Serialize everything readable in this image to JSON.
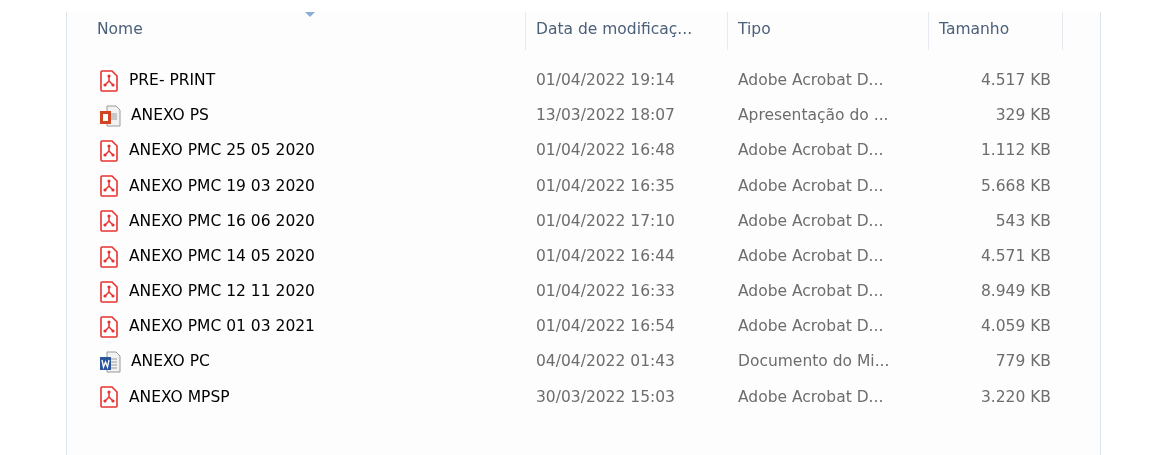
{
  "columns": [
    {
      "label": "Nome",
      "sorted": true
    },
    {
      "label": "Data de modificaç...",
      "sorted": false
    },
    {
      "label": "Tipo",
      "sorted": false
    },
    {
      "label": "Tamanho",
      "sorted": false
    }
  ],
  "files": [
    {
      "kind": "pdf",
      "name": "PRE- PRINT",
      "date": "01/04/2022 19:14",
      "type": "Adobe Acrobat D...",
      "size": "4.517 KB"
    },
    {
      "kind": "ppt",
      "name": "ANEXO PS",
      "date": "13/03/2022 18:07",
      "type": "Apresentação do ...",
      "size": "329 KB"
    },
    {
      "kind": "pdf",
      "name": "ANEXO PMC 25 05 2020",
      "date": "01/04/2022 16:48",
      "type": "Adobe Acrobat D...",
      "size": "1.112 KB"
    },
    {
      "kind": "pdf",
      "name": "ANEXO PMC 19 03 2020",
      "date": "01/04/2022 16:35",
      "type": "Adobe Acrobat D...",
      "size": "5.668 KB"
    },
    {
      "kind": "pdf",
      "name": "ANEXO PMC 16 06 2020",
      "date": "01/04/2022 17:10",
      "type": "Adobe Acrobat D...",
      "size": "543 KB"
    },
    {
      "kind": "pdf",
      "name": "ANEXO PMC 14 05 2020",
      "date": "01/04/2022 16:44",
      "type": "Adobe Acrobat D...",
      "size": "4.571 KB"
    },
    {
      "kind": "pdf",
      "name": "ANEXO PMC 12 11 2020",
      "date": "01/04/2022 16:33",
      "type": "Adobe Acrobat D...",
      "size": "8.949 KB"
    },
    {
      "kind": "pdf",
      "name": "ANEXO PMC 01 03 2021",
      "date": "01/04/2022 16:54",
      "type": "Adobe Acrobat D...",
      "size": "4.059 KB"
    },
    {
      "kind": "doc",
      "name": "ANEXO PC",
      "date": "04/04/2022 01:43",
      "type": "Documento do Mi...",
      "size": "779 KB"
    },
    {
      "kind": "pdf",
      "name": "ANEXO MPSP",
      "date": "30/03/2022 15:03",
      "type": "Adobe Acrobat D...",
      "size": "3.220 KB"
    }
  ]
}
